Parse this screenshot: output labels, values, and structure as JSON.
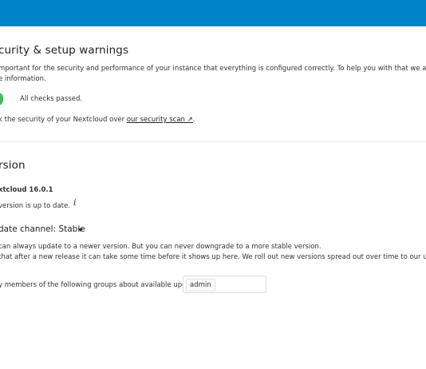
{
  "security": {
    "title": "curity & setup warnings",
    "intro_line1": "mportant for the security and performance of your instance that everything is configured correctly. To help you with that we are doing some au",
    "intro_line2": "e information.",
    "checks_status": "All checks passed.",
    "scan_prefix": "k the security of your Nextcloud over ",
    "scan_link": "our security scan ↗",
    "scan_suffix": "."
  },
  "version": {
    "title": "rsion",
    "product": "xtcloud 16.0.1",
    "status": "version is up to date.",
    "info_icon": "info-icon",
    "channel_label": "date channel:",
    "channel_value": "Stable",
    "note_line1": "can always update to a newer version. But you can never downgrade to a more stable version.",
    "note_line2": " that after a new release it can take some time before it shows up here. We roll out new versions spread out over time to our users and someti",
    "notify_label": "y members of the following groups about available updates:",
    "notify_group": "admin"
  },
  "colors": {
    "header": "#0082c9",
    "success": "#46ba61"
  }
}
